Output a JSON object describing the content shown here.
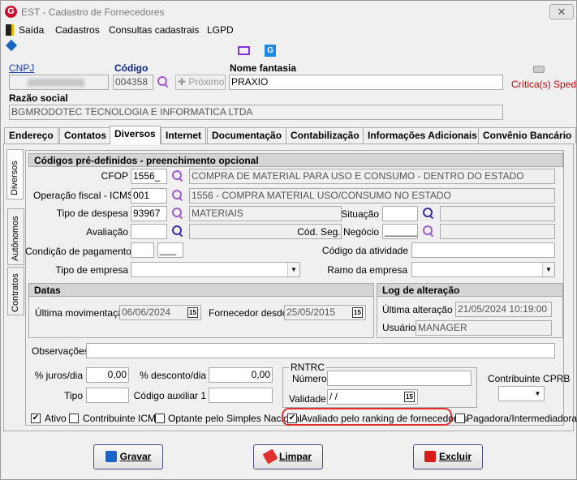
{
  "window": {
    "title": "EST - Cadastro de Fornecedores",
    "close": "✕"
  },
  "menu": {
    "items": [
      "Saída",
      "Cadastros",
      "Consultas cadastrais",
      "LGPD"
    ]
  },
  "header": {
    "cnpj_label": "CNPJ",
    "codigo_label": "Código",
    "codigo_value": "004358",
    "proximo_label": "Próximo",
    "nome_fantasia_label": "Nome fantasia",
    "nome_fantasia_value": "PRAXIO",
    "critica_label": "Crítica(s) Sped",
    "razao_social_label": "Razão social",
    "razao_social_value": "BGMRODOTEC TECNOLOGIA E INFORMATICA LTDA"
  },
  "tabs": [
    "Endereço",
    "Contatos",
    "Diversos",
    "Internet",
    "Documentação",
    "Contabilização",
    "Informações Adicionais",
    "Convênio Bancário"
  ],
  "side_tabs": [
    "Diversos",
    "Autônomos",
    "Contratos"
  ],
  "codigos": {
    "title": "Códigos pré-definidos - preenchimento opcional",
    "cfop_label": "CFOP",
    "cfop_value": "1556_",
    "cfop_desc": "COMPRA DE MATERIAL PARA USO E CONSUMO - DENTRO DO ESTADO",
    "opfiscal_label": "Operação fiscal - ICMS",
    "opfiscal_value": "001",
    "opfiscal_desc": "1556 - COMPRA MATERIAL USO/CONSUMO NO ESTADO",
    "tipodespesa_label": "Tipo de despesa",
    "tipodespesa_value": "93967",
    "tipodespesa_desc": "MATERIAIS",
    "situacao_label": "Situação",
    "avaliacao_label": "Avaliação",
    "codseg_label": "Cód. Seg. Negócio",
    "codseg_value": "______",
    "condpag_label": "Condição de pagamento",
    "condpag_value2": "___",
    "codatividade_label": "Código da atividade",
    "tipoempresa_label": "Tipo de empresa",
    "ramo_label": "Ramo da empresa"
  },
  "datas": {
    "title": "Datas",
    "ultima_mov_label": "Última movimentação",
    "ultima_mov_value": "06/06/2024",
    "forn_desde_label": "Fornecedor desde",
    "forn_desde_value": "25/05/2015"
  },
  "log": {
    "title": "Log de alteração",
    "ultima_alt_label": "Última alteração",
    "ultima_alt_value": "21/05/2024 10:19:00",
    "usuario_label": "Usuário",
    "usuario_value": "MANAGER"
  },
  "obs_label": "Observações",
  "juros_label": "% juros/dia",
  "juros_value": "0,00",
  "desconto_label": "% desconto/dia",
  "desconto_value": "0,00",
  "tipo_label": "Tipo",
  "codaux_label": "Código auxiliar 1",
  "rntrc": {
    "title": "RNTRC",
    "numero_label": "Número",
    "validade_label": "Validade",
    "validade_value": " / /"
  },
  "cprb_label": "Contribuinte CPRB",
  "checks": {
    "ativo": "Ativo",
    "contrib_icms": "Contribuinte ICMS",
    "simples": "Optante pelo Simples Nacional",
    "ranking": "Avaliado pelo ranking de fornecedores",
    "pagadora": "Pagadora/Intermediadora"
  },
  "buttons": {
    "gravar": "Gravar",
    "limpar": "Limpar",
    "excluir": "Excluir"
  }
}
